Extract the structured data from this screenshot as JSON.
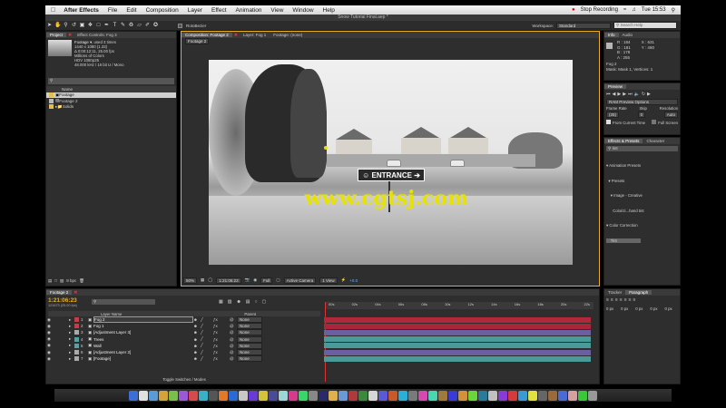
{
  "menubar": {
    "app_name": "After Effects",
    "items": [
      "File",
      "Edit",
      "Composition",
      "Layer",
      "Effect",
      "Animation",
      "View",
      "Window",
      "Help"
    ],
    "stop_recording": "Stop Recording",
    "clock": "Tue 15:53"
  },
  "window_title": "Snow Tutorial Final.aep *",
  "toolbar": {
    "roto_label": "RotoBezier",
    "workspace_label": "Workspace:",
    "workspace_value": "Standard",
    "search_placeholder": "Search Help"
  },
  "project_panel": {
    "tab_project": "Project",
    "tab_effect_controls": "Effect Controls: Fog 3",
    "footage_name": "Footage ▾",
    "used": ", used 3 times",
    "info_lines": [
      "1440 x 1080 (1.33)",
      "Δ 0:00:12:11, 25.00 fps",
      "Millions of Colors",
      "HDV 1080p25",
      "48.000 kHz / 16 bit U / Mono"
    ],
    "column_name": "Name",
    "items": [
      {
        "label": "Footage",
        "type": "footage"
      },
      {
        "label": "Footage 2",
        "type": "comp"
      },
      {
        "label": "Solids",
        "type": "folder"
      }
    ],
    "bpc": "8 bpc"
  },
  "comp_panel": {
    "tab_comp": "Composition: Footage 2",
    "tab_layer": "Layer: Fog 1",
    "tab_footage": "Footage: (none)",
    "breadcrumb": "Footage 2",
    "sign_text": "ENTRANCE",
    "watermark": "www.cgtsj.com",
    "zoom": "50%",
    "timecode": "1:21:06:23",
    "resolution": "Full",
    "camera": "Active Camera",
    "view": "1 View",
    "exposure": "+0.0"
  },
  "info_panel": {
    "tab_info": "Info",
    "tab_audio": "Audio",
    "r": "R : 184",
    "g": "G : 181",
    "b": "B : 178",
    "a": "A : 255",
    "x": "X : 631",
    "y": "Y : 480",
    "layer_name": "Fog 2",
    "mask_info": "Mask: Mask 1, Vertices: 1"
  },
  "preview_panel": {
    "tab": "Preview",
    "ram_options": "RAM Preview Options",
    "frame_rate_label": "Frame Rate",
    "skip_label": "Skip",
    "resolution_label": "Resolution",
    "frame_rate_value": "(25)",
    "skip_value": "0",
    "resolution_value": "Auto",
    "from_current": "From Current Time",
    "full_screen": "Full Screen"
  },
  "effects_panel": {
    "tab_effects": "Effects & Presets",
    "tab_character": "Character",
    "search_value": "tint",
    "tree": [
      "▾ Animation Presets",
      "  ▾ Presets",
      "    ▾ Image - Creative",
      "      Colorizi...hand tint",
      "▾ Color Correction",
      "    Tint"
    ]
  },
  "paragraph_panel": {
    "tab_tracker": "Tracker",
    "tab_paragraph": "Paragraph",
    "fields": [
      "0 px",
      "0 px",
      "0 px",
      "0 px",
      "0 px"
    ]
  },
  "timeline": {
    "tab": "Footage 2",
    "timecode": "1:21:06:23",
    "timecode_sub": "121673 (25.00 fps)",
    "col_layer": "Layer Name",
    "col_parent": "Parent",
    "ruler": [
      "00s",
      "02s",
      "04s",
      "06s",
      "08s",
      "10s",
      "12s",
      "14s",
      "16s",
      "18s",
      "20s",
      "22s"
    ],
    "layers": [
      {
        "num": "1",
        "name": "Fog 2",
        "color": "#c0404a",
        "bar": "#b0283a"
      },
      {
        "num": "2",
        "name": "Fog 1",
        "color": "#c0404a",
        "bar": "#a82638"
      },
      {
        "num": "3",
        "name": "[Adjustment Layer 3]",
        "color": "#aaaaaa",
        "bar": "#6a5fa0"
      },
      {
        "num": "4",
        "name": "Trees",
        "color": "#5aa0a0",
        "bar": "#4a9a9a"
      },
      {
        "num": "5",
        "name": "Wall",
        "color": "#5aa0a0",
        "bar": "#4a9a9a"
      },
      {
        "num": "6",
        "name": "[Adjustment Layer 2]",
        "color": "#aaaaaa",
        "bar": "#6a5fa0"
      },
      {
        "num": "7",
        "name": "[Footage]",
        "color": "#aaaaaa",
        "bar": "#4a9a9a"
      }
    ],
    "parent_value": "None",
    "toggle_label": "Toggle Switches / Modes"
  },
  "colors": {
    "accent": "#e8b020",
    "panel": "#2e2e2e",
    "watermark": "#e8e200"
  }
}
